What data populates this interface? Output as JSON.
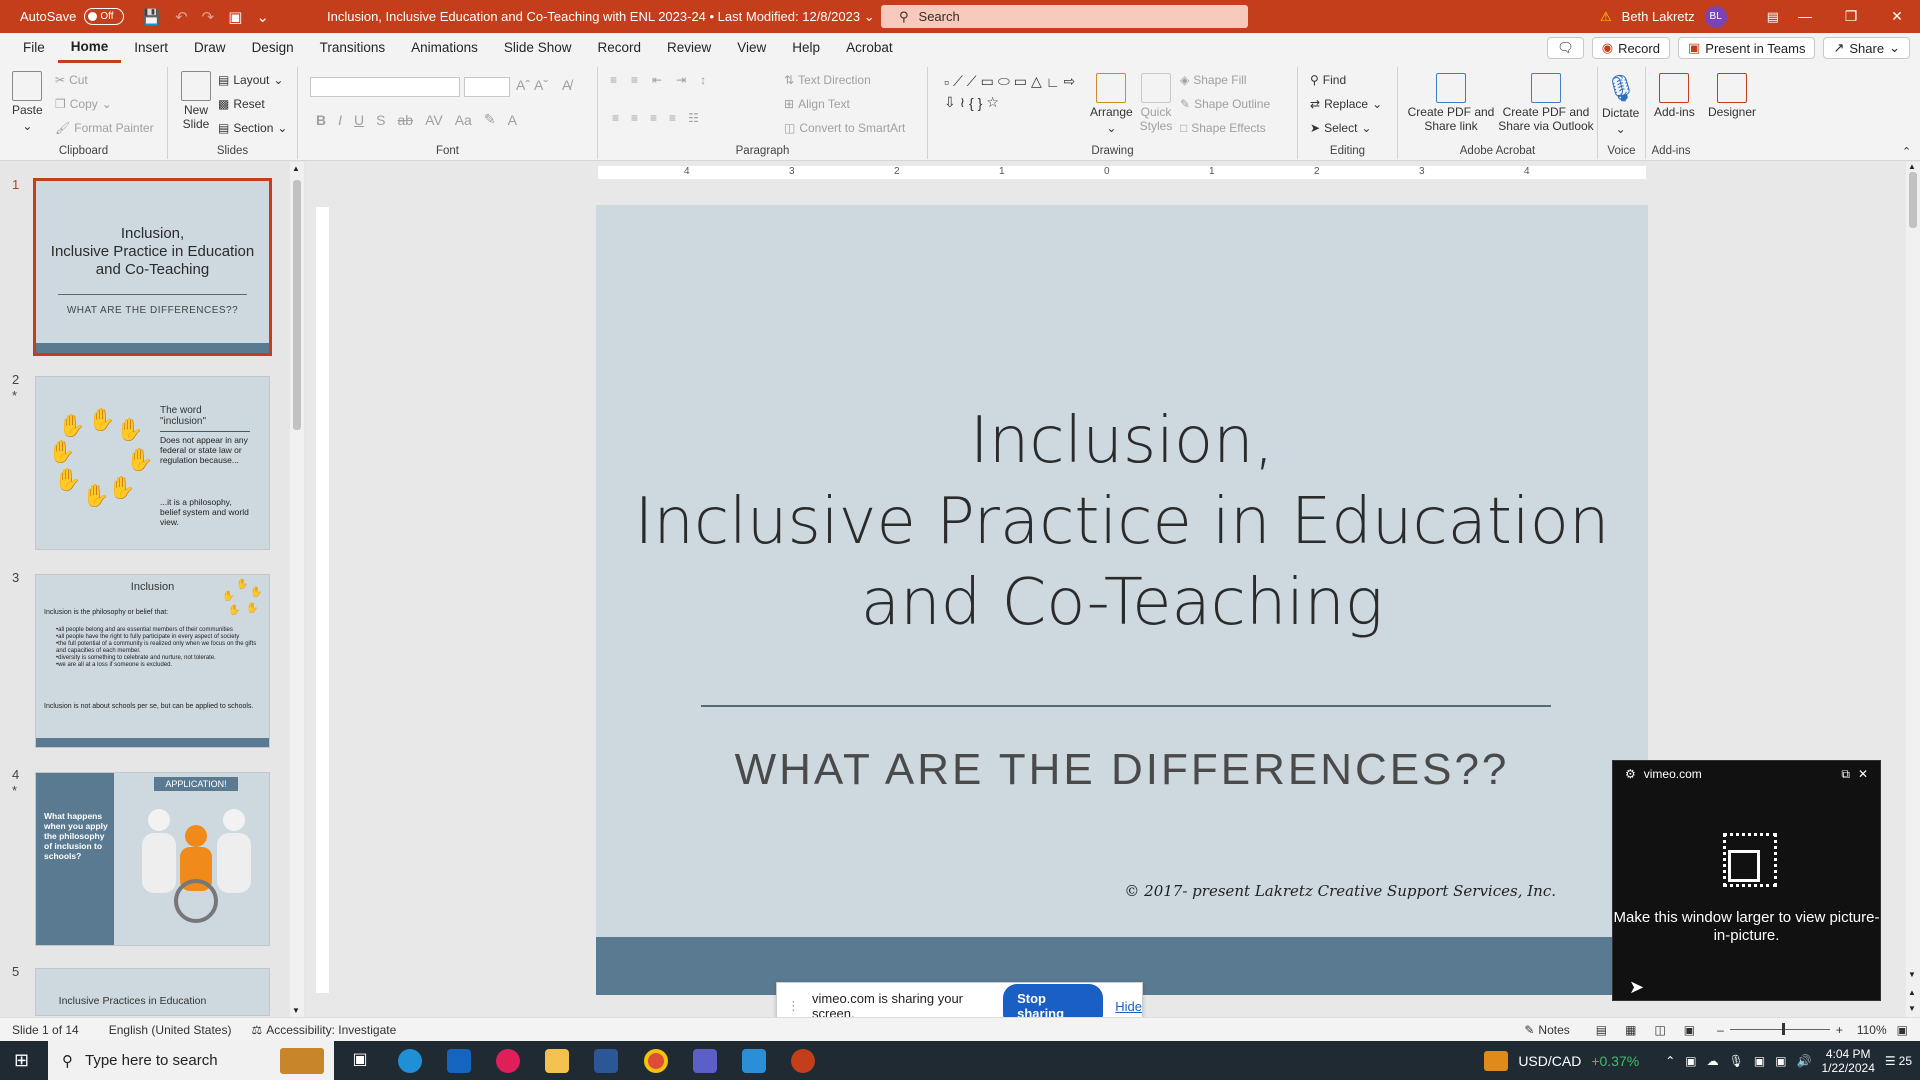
{
  "titlebar": {
    "autosave_label": "AutoSave",
    "autosave_state": "Off",
    "document_title": "Inclusion, Inclusive Education and Co-Teaching with ENL 2023-24  •  Last Modified: 12/8/2023",
    "search_placeholder": "Search",
    "user_name": "Beth Lakretz",
    "user_initials": "BL"
  },
  "tabs": [
    "File",
    "Home",
    "Insert",
    "Draw",
    "Design",
    "Transitions",
    "Animations",
    "Slide Show",
    "Record",
    "Review",
    "View",
    "Help",
    "Acrobat"
  ],
  "active_tab": "Home",
  "menu_right": {
    "record": "Record",
    "present_teams": "Present in Teams",
    "share": "Share"
  },
  "ribbon": {
    "clipboard": {
      "label": "Clipboard",
      "paste": "Paste",
      "cut": "Cut",
      "copy": "Copy",
      "format_painter": "Format Painter"
    },
    "slides": {
      "label": "Slides",
      "new_slide": "New Slide",
      "layout": "Layout",
      "reset": "Reset",
      "section": "Section"
    },
    "font": {
      "label": "Font"
    },
    "paragraph": {
      "label": "Paragraph",
      "text_direction": "Text Direction",
      "align_text": "Align Text",
      "convert_smartart": "Convert to SmartArt"
    },
    "drawing": {
      "label": "Drawing",
      "arrange": "Arrange",
      "quick_styles": "Quick Styles",
      "shape_fill": "Shape Fill",
      "shape_outline": "Shape Outline",
      "shape_effects": "Shape Effects"
    },
    "editing": {
      "label": "Editing",
      "find": "Find",
      "replace": "Replace",
      "select": "Select"
    },
    "acrobat": {
      "label": "Adobe Acrobat",
      "create_share_link": "Create PDF and Share link",
      "create_share_outlook": "Create PDF and Share via Outlook"
    },
    "voice": {
      "label": "Voice",
      "dictate": "Dictate"
    },
    "addins": {
      "label": "Add-ins",
      "addins": "Add-ins",
      "designer": "Designer"
    }
  },
  "thumbnails": [
    {
      "num": "1",
      "title": "Inclusion,\nInclusive Practice in Education\nand Co-Teaching",
      "subtitle": "WHAT ARE THE DIFFERENCES??"
    },
    {
      "num": "2",
      "star": "*",
      "title": "The word \"inclusion\"",
      "body": "Does not appear in any federal or state law or regulation because...",
      "body2": "...it is a philosophy, belief system and world view."
    },
    {
      "num": "3",
      "title": "Inclusion",
      "body": "Inclusion is the philosophy or belief that:",
      "bullets": [
        "all people belong and are essential members of their communities",
        "all people have the right to fully participate in every aspect of society",
        "the full potential of a community is realized only when we focus on the gifts and capacities of each member.",
        "diversity is something to celebrate and nurture, not tolerate.",
        "we are all at a loss if someone is excluded."
      ],
      "body2": "Inclusion is not about schools per se, but can be applied to schools."
    },
    {
      "num": "4",
      "star": "*",
      "title": "APPLICATION!",
      "body": "What happens when you apply the philosophy of inclusion to schools?"
    },
    {
      "num": "5",
      "title": "Inclusive Practices in Education"
    }
  ],
  "slide": {
    "title_line1": "Inclusion,",
    "title_line2": "Inclusive Practice in Education",
    "title_line3": "and Co-Teaching",
    "subtitle": "WHAT ARE THE DIFFERENCES??",
    "copyright": "© 2017- present Lakretz Creative Support Services, Inc."
  },
  "ruler_ticks": [
    "4",
    "3",
    "2",
    "1",
    "0",
    "1",
    "2",
    "3",
    "4"
  ],
  "pip": {
    "source": "vimeo.com",
    "message": "Make this window larger to view picture-in-picture."
  },
  "sharing": {
    "message": "vimeo.com is sharing your screen.",
    "stop": "Stop sharing",
    "hide": "Hide"
  },
  "status": {
    "slide_count": "Slide 1 of 14",
    "language": "English (United States)",
    "accessibility": "Accessibility: Investigate",
    "notes": "Notes",
    "zoom": "110%"
  },
  "taskbar": {
    "search_placeholder": "Type here to search",
    "ticker": "USD/CAD",
    "ticker_change": "+0.37%",
    "time": "4:04 PM",
    "date": "1/22/2024",
    "notifications": "25"
  }
}
